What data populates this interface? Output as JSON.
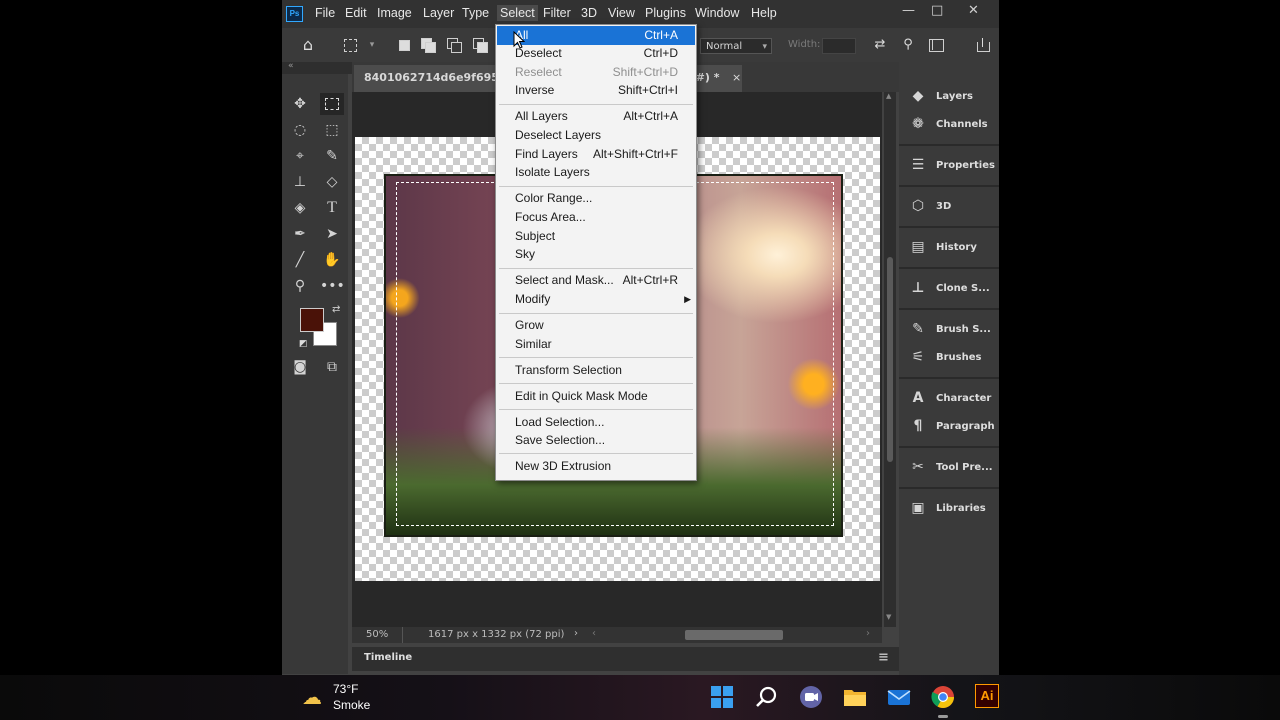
{
  "menubar": {
    "logo": "Ps",
    "items": [
      "File",
      "Edit",
      "Image",
      "Layer",
      "Type",
      "Select",
      "Filter",
      "3D",
      "View",
      "Plugins",
      "Window",
      "Help"
    ],
    "active_item": "Select",
    "window_controls": {
      "minimize": "—",
      "maximize": "□",
      "close": "✕"
    }
  },
  "options_bar": {
    "mode_value": "Normal",
    "width_label": "Width:"
  },
  "document": {
    "tab_title_left": "8401062714d6e9f695dfd",
    "tab_title_right": "/8#) *",
    "close_glyph": "×"
  },
  "collapse_glyph": "«",
  "status_bar": {
    "zoom": "50%",
    "doc_info": "1617 px x 1332 px (72 ppi)",
    "arrow_right": "›",
    "arrow_left": "‹"
  },
  "timeline": {
    "label": "Timeline",
    "menu_glyph": "≡"
  },
  "panels": [
    {
      "label": "Layers",
      "icon": "layers-icon"
    },
    {
      "label": "Channels",
      "icon": "channels-icon"
    },
    {
      "label": "Properties",
      "icon": "properties-icon"
    },
    {
      "label": "3D",
      "icon": "cube-icon"
    },
    {
      "label": "History",
      "icon": "history-icon"
    },
    {
      "label": "Clone S...",
      "icon": "clone-source-icon"
    },
    {
      "label": "Brush S...",
      "icon": "brush-settings-icon"
    },
    {
      "label": "Brushes",
      "icon": "brushes-icon"
    },
    {
      "label": "Character",
      "icon": "character-icon"
    },
    {
      "label": "Paragraph",
      "icon": "paragraph-icon"
    },
    {
      "label": "Tool Pre...",
      "icon": "tool-presets-icon"
    },
    {
      "label": "Libraries",
      "icon": "libraries-icon"
    }
  ],
  "select_menu": {
    "items": [
      {
        "label": "All",
        "shortcut": "Ctrl+A",
        "highlighted": true
      },
      {
        "label": "Deselect",
        "shortcut": "Ctrl+D"
      },
      {
        "label": "Reselect",
        "shortcut": "Shift+Ctrl+D",
        "disabled": true
      },
      {
        "label": "Inverse",
        "shortcut": "Shift+Ctrl+I"
      },
      {
        "label": "All Layers",
        "shortcut": "Alt+Ctrl+A"
      },
      {
        "label": "Deselect Layers",
        "shortcut": ""
      },
      {
        "label": "Find Layers",
        "shortcut": "Alt+Shift+Ctrl+F"
      },
      {
        "label": "Isolate Layers",
        "shortcut": ""
      },
      {
        "label": "Color Range...",
        "shortcut": ""
      },
      {
        "label": "Focus Area...",
        "shortcut": ""
      },
      {
        "label": "Subject",
        "shortcut": ""
      },
      {
        "label": "Sky",
        "shortcut": ""
      },
      {
        "label": "Select and Mask...",
        "shortcut": "Alt+Ctrl+R"
      },
      {
        "label": "Modify",
        "shortcut": "",
        "submenu": true
      },
      {
        "label": "Grow",
        "shortcut": ""
      },
      {
        "label": "Similar",
        "shortcut": ""
      },
      {
        "label": "Transform Selection",
        "shortcut": ""
      },
      {
        "label": "Edit in Quick Mask Mode",
        "shortcut": ""
      },
      {
        "label": "Load Selection...",
        "shortcut": ""
      },
      {
        "label": "Save Selection...",
        "shortcut": ""
      },
      {
        "label": "New 3D Extrusion",
        "shortcut": ""
      }
    ],
    "submenu_arrow": "▶"
  },
  "colors": {
    "foreground": "#4a1208",
    "background": "#ffffff",
    "highlight": "#1a73d6"
  },
  "taskbar": {
    "weather_temp": "73°F",
    "weather_desc": "Smoke",
    "apps": [
      "windows-start-icon",
      "search-icon",
      "teams-chat-icon",
      "file-explorer-icon",
      "mail-icon",
      "chrome-icon",
      "illustrator-icon"
    ],
    "illustrator_label": "Ai"
  }
}
